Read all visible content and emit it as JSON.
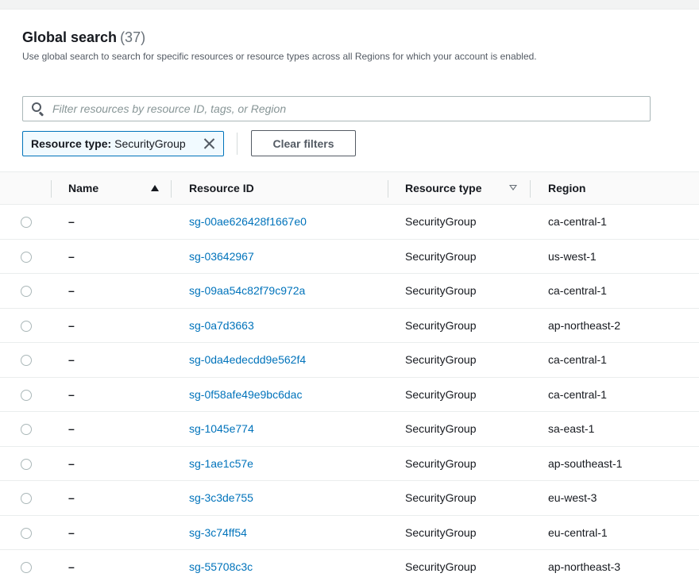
{
  "header": {
    "title": "Global search",
    "count": "(37)",
    "description": "Use global search to search for specific resources or resource types across all Regions for which your account is enabled."
  },
  "search": {
    "placeholder": "Filter resources by resource ID, tags, or Region",
    "value": "",
    "icon": "search-icon"
  },
  "filter_token": {
    "key": "Resource type:",
    "value": "SecurityGroup",
    "close_icon": "close-icon"
  },
  "clear_filters_label": "Clear filters",
  "table": {
    "columns": {
      "name": "Name",
      "resource_id": "Resource ID",
      "resource_type": "Resource type",
      "region": "Region"
    },
    "rows": [
      {
        "name": "–",
        "resource_id": "sg-00ae626428f1667e0",
        "resource_type": "SecurityGroup",
        "region": "ca-central-1"
      },
      {
        "name": "–",
        "resource_id": "sg-03642967",
        "resource_type": "SecurityGroup",
        "region": "us-west-1"
      },
      {
        "name": "–",
        "resource_id": "sg-09aa54c82f79c972a",
        "resource_type": "SecurityGroup",
        "region": "ca-central-1"
      },
      {
        "name": "–",
        "resource_id": "sg-0a7d3663",
        "resource_type": "SecurityGroup",
        "region": "ap-northeast-2"
      },
      {
        "name": "–",
        "resource_id": "sg-0da4edecdd9e562f4",
        "resource_type": "SecurityGroup",
        "region": "ca-central-1"
      },
      {
        "name": "–",
        "resource_id": "sg-0f58afe49e9bc6dac",
        "resource_type": "SecurityGroup",
        "region": "ca-central-1"
      },
      {
        "name": "–",
        "resource_id": "sg-1045e774",
        "resource_type": "SecurityGroup",
        "region": "sa-east-1"
      },
      {
        "name": "–",
        "resource_id": "sg-1ae1c57e",
        "resource_type": "SecurityGroup",
        "region": "ap-southeast-1"
      },
      {
        "name": "–",
        "resource_id": "sg-3c3de755",
        "resource_type": "SecurityGroup",
        "region": "eu-west-3"
      },
      {
        "name": "–",
        "resource_id": "sg-3c74ff54",
        "resource_type": "SecurityGroup",
        "region": "eu-central-1"
      },
      {
        "name": "–",
        "resource_id": "sg-55708c3c",
        "resource_type": "SecurityGroup",
        "region": "ap-northeast-3"
      }
    ]
  },
  "colors": {
    "link": "#0073bb",
    "text": "#16191f",
    "muted": "#687078",
    "token_border": "#0073bb",
    "token_bg": "#f1faff"
  }
}
